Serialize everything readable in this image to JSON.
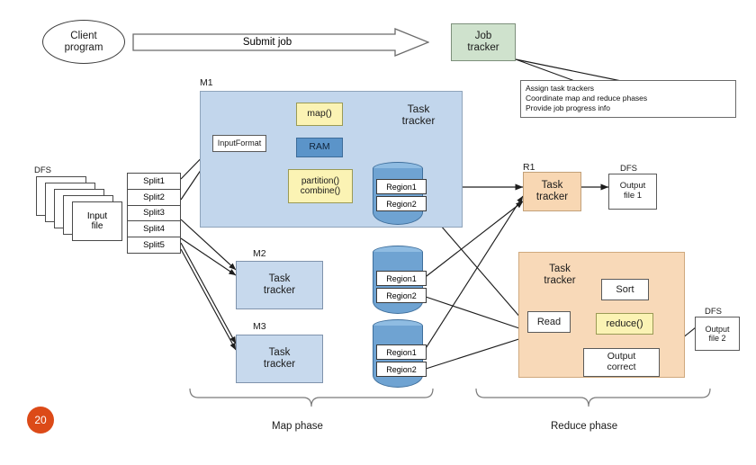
{
  "slide": {
    "page_number": "20",
    "title_alt": "MapReduce execution overview"
  },
  "client": {
    "line1": "Client",
    "line2": "program"
  },
  "submit_arrow": {
    "label": "Submit job"
  },
  "job_tracker": {
    "line1": "Job",
    "line2": "tracker"
  },
  "job_tracker_notes": {
    "lines": [
      "Assign task trackers",
      "Coordinate map and reduce phases",
      "Provide job progress info"
    ]
  },
  "dfs_input": {
    "label": "DFS",
    "file_line1": "Input",
    "file_line2": "file"
  },
  "splits": {
    "items": [
      "Split1",
      "Split2",
      "Split3",
      "Split4",
      "Split5"
    ]
  },
  "mappers": [
    {
      "id": "M1",
      "tracker_line1": "Task",
      "tracker_line2": "tracker",
      "input_format": "InputFormat",
      "map_fn": "map()",
      "ram": "RAM",
      "partition_line1": "partition()",
      "partition_line2": "combine()",
      "regions": [
        "Region1",
        "Region2"
      ]
    },
    {
      "id": "M2",
      "tracker_line1": "Task",
      "tracker_line2": "tracker",
      "regions": [
        "Region1",
        "Region2"
      ]
    },
    {
      "id": "M3",
      "tracker_line1": "Task",
      "tracker_line2": "tracker",
      "regions": [
        "Region1",
        "Region2"
      ]
    }
  ],
  "reducer_r1": {
    "id": "R1",
    "tracker_line1": "Task",
    "tracker_line2": "tracker",
    "dfs_label": "DFS",
    "output_line1": "Output",
    "output_line2": "file 1"
  },
  "reducer_r2": {
    "tracker_line1": "Task",
    "tracker_line2": "tracker",
    "read": "Read",
    "sort": "Sort",
    "reduce_fn": "reduce()",
    "output_line1": "Output",
    "output_line2": "correct",
    "dfs_label": "DFS",
    "out_file_line1": "Output",
    "out_file_line2": "file 2"
  },
  "phases": {
    "map": "Map phase",
    "reduce": "Reduce phase"
  },
  "colors": {
    "job_tracker_green": "#cfe2cd",
    "mapper_panel_blue": "#c2d6ec",
    "task_tracker_blue": "#c7d9ed",
    "ram_blue": "#5b94c9",
    "code_yellow": "#fbf3b4",
    "reducer_orange": "#f8d9b8",
    "cylinder_blue": "#6fa3d2",
    "badge_orange": "#dc4a18",
    "stroke": "#4a4a4a"
  }
}
